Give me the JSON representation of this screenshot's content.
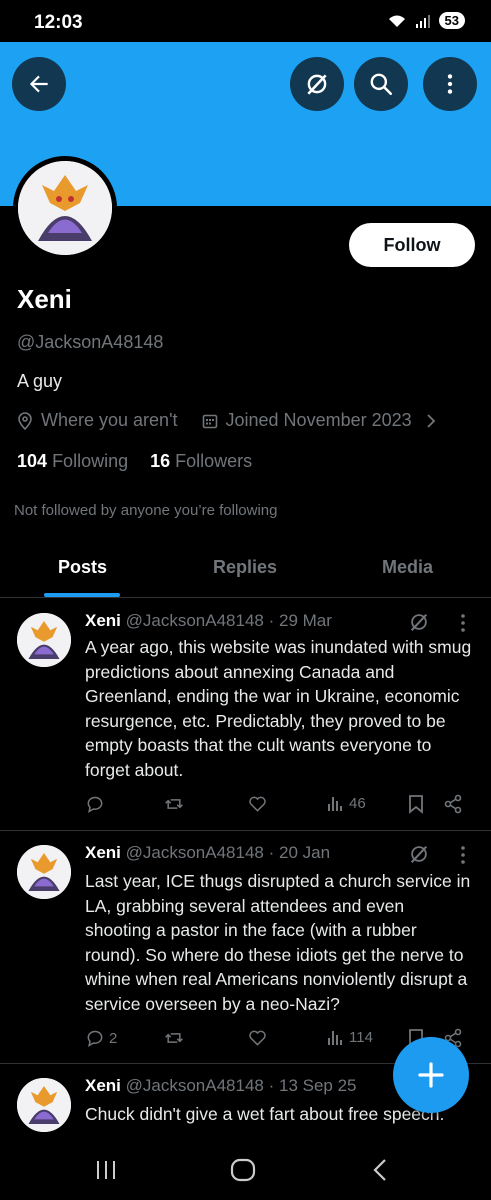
{
  "status_bar": {
    "time": "12:03",
    "battery": "53",
    "network": "5"
  },
  "header": {
    "back_icon": "arrow-left-icon",
    "grok_icon": "grok-icon",
    "search_icon": "search-icon",
    "more_icon": "more-vertical-icon",
    "banner_color": "#1da1f2"
  },
  "profile": {
    "follow_label": "Follow",
    "name": "Xeni",
    "handle": "@JacksonA48148",
    "bio": "A guy",
    "location": "Where you aren't",
    "joined": "Joined November 2023",
    "following_count": "104",
    "following_label": "Following",
    "followers_count": "16",
    "followers_label": "Followers",
    "not_followed": "Not followed by anyone you’re following"
  },
  "tabs": [
    {
      "label": "Posts",
      "active": true
    },
    {
      "label": "Replies",
      "active": false
    },
    {
      "label": "Media",
      "active": false
    }
  ],
  "posts": [
    {
      "name": "Xeni",
      "handle": "@JacksonA48148",
      "date": "· 29 Mar",
      "text": "A year ago, this website was inundated with smug predictions about annexing Canada and Greenland, ending the war in Ukraine, economic resurgence, etc. Predictably, they proved to be empty boasts that the cult wants everyone to forget about.",
      "replies": "",
      "reposts": "",
      "likes": "",
      "views": "46"
    },
    {
      "name": "Xeni",
      "handle": "@JacksonA48148",
      "date": "· 20 Jan",
      "text": "Last year, ICE thugs disrupted a church service in LA, grabbing several attendees and even shooting a pastor in the face (with a rubber round). So where do these idiots get the nerve to whine when real Americans nonviolently disrupt a service overseen by a neo-Nazi?",
      "replies": "2",
      "reposts": "",
      "likes": "",
      "views": "114"
    },
    {
      "name": "Xeni",
      "handle": "@JacksonA48148",
      "date": "· 13 Sep 25",
      "text": "Chuck didn't give a wet fart about free speech.",
      "replies": "",
      "reposts": "",
      "likes": "",
      "views": ""
    }
  ],
  "fab_icon": "plus-icon",
  "accent_color": "#1d9bf0"
}
